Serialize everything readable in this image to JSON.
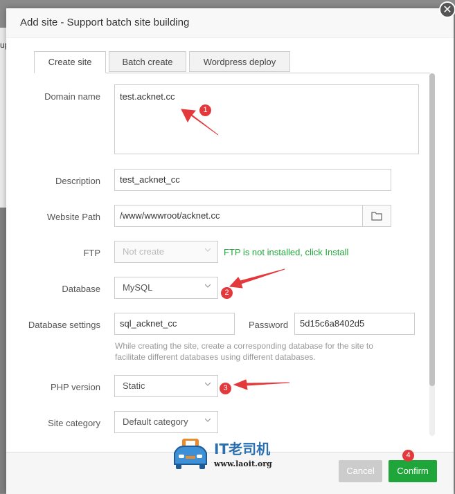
{
  "background": {
    "fragment": "up"
  },
  "dialog": {
    "title": "Add site - Support batch site building",
    "close_icon": "close-icon"
  },
  "tabs": [
    {
      "label": "Create site",
      "active": true
    },
    {
      "label": "Batch create",
      "active": false
    },
    {
      "label": "Wordpress deploy",
      "active": false
    }
  ],
  "form": {
    "domain": {
      "label": "Domain name",
      "value": "test.acknet.cc"
    },
    "description": {
      "label": "Description",
      "value": "test_acknet_cc"
    },
    "path": {
      "label": "Website Path",
      "value": "/www/wwwroot/acknet.cc",
      "icon": "folder-icon"
    },
    "ftp": {
      "label": "FTP",
      "value": "Not create",
      "tip": "FTP is not installed, click Install"
    },
    "database": {
      "label": "Database",
      "value": "MySQL"
    },
    "db_settings": {
      "label": "Database settings",
      "db_name": "sql_acknet_cc",
      "password_label": "Password",
      "password": "5d15c6a8402d5",
      "hint": "While creating the site, create a corresponding database for the site to facilitate different databases using different databases."
    },
    "php": {
      "label": "PHP version",
      "value": "Static"
    },
    "category": {
      "label": "Site category",
      "value": "Default category"
    }
  },
  "footer": {
    "cancel": "Cancel",
    "confirm": "Confirm"
  },
  "annotations": [
    "1",
    "2",
    "3",
    "4"
  ],
  "watermark": {
    "title": "IT老司机",
    "url": "www.laoit.org"
  },
  "colors": {
    "accent": "#20a53a",
    "annotation": "#e4393c",
    "disabled_button": "#cccccc"
  }
}
